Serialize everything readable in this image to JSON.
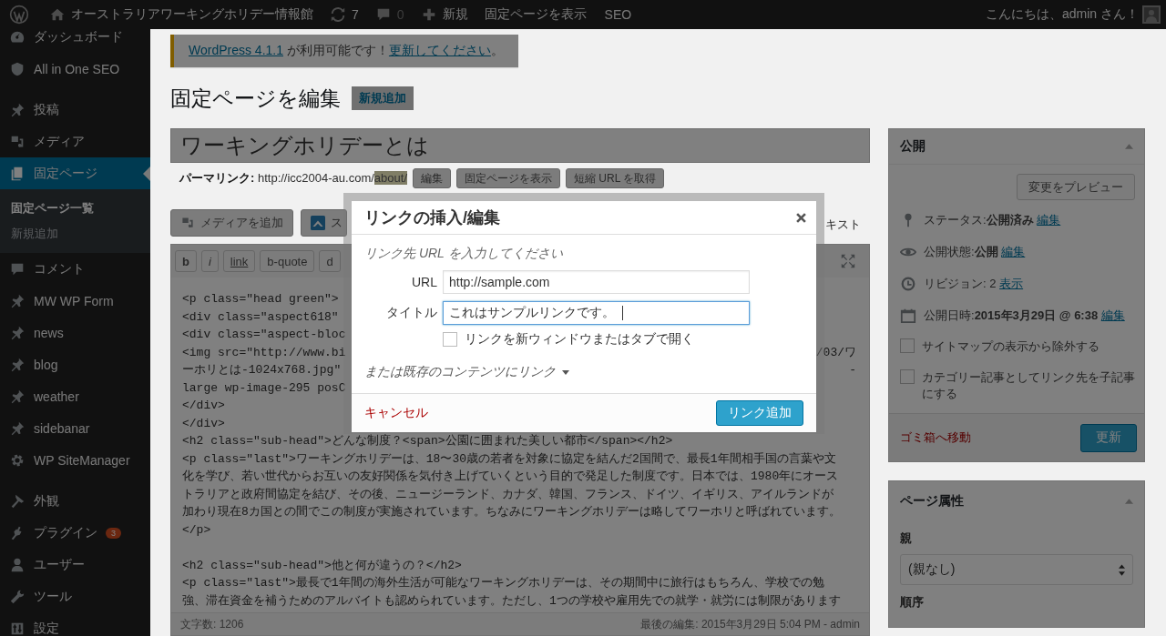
{
  "admin_bar": {
    "site_name": "オーストラリアワーキングホリデー情報館",
    "updates": "7",
    "comments": "0",
    "new": "新規",
    "view_page": "固定ページを表示",
    "seo": "SEO",
    "greeting": "こんにちは、admin さん！"
  },
  "sidebar": {
    "groups": [
      [
        {
          "label": "ダッシュボード",
          "selected": false
        },
        {
          "label": "All in One SEO",
          "selected": false
        }
      ],
      [
        {
          "label": "投稿",
          "selected": false
        },
        {
          "label": "メディア",
          "selected": false
        },
        {
          "label": "固定ページ",
          "selected": true,
          "children": [
            {
              "label": "固定ページ一覧",
              "selected": true
            },
            {
              "label": "新規追加",
              "selected": false
            }
          ]
        },
        {
          "label": "コメント",
          "selected": false
        },
        {
          "label": "MW WP Form",
          "selected": false
        },
        {
          "label": "news",
          "selected": false
        },
        {
          "label": "blog",
          "selected": false
        },
        {
          "label": "weather",
          "selected": false
        },
        {
          "label": "sidebanar",
          "selected": false
        },
        {
          "label": "WP SiteManager",
          "selected": false
        }
      ],
      [
        {
          "label": "外観",
          "selected": false
        },
        {
          "label": "プラグイン",
          "selected": false,
          "badge": "3"
        },
        {
          "label": "ユーザー",
          "selected": false
        },
        {
          "label": "ツール",
          "selected": false
        },
        {
          "label": "設定",
          "selected": false
        }
      ]
    ]
  },
  "notice": {
    "version_link": "WordPress 4.1.1",
    "message": "が利用可能です！",
    "update_link": "更新してください",
    "end": "。"
  },
  "page": {
    "heading": "固定ページを編集",
    "add_new": "新規追加",
    "title": "ワーキングホリデーとは",
    "permalink": {
      "label": "パーマリンク:",
      "base": "http://icc2004-au.com/",
      "slug": "about/",
      "buttons": [
        "編集",
        "固定ページを表示",
        "短縮 URL を取得"
      ]
    }
  },
  "editor": {
    "media_buttons": [
      "メディアを追加",
      "ス"
    ],
    "tab": "キスト",
    "quicktags": [
      "b",
      "i",
      "link",
      "b-quote",
      "d"
    ],
    "lines": [
      {
        "left": "<p class=\"head green\">"
      },
      {
        "left": "<div class=\"aspect618\""
      },
      {
        "left": "<div class=\"aspect-bloc"
      },
      {
        "left": "<img src=\"http://www.bi",
        "right": "/03/ワ"
      },
      {
        "left": "ーホリとは-1024x768.jpg\"",
        "right": "-"
      },
      {
        "left": "large wp-image-295 posC"
      },
      {
        "left": "</div>"
      },
      {
        "left": "</div>"
      },
      {
        "left": "<h2 class=\"sub-head\">どんな制度？<span>公園に囲まれた美しい都市</span></h2>"
      },
      {
        "left": "<p class=\"last\">ワーキングホリデーは、18〜30歳の若者を対象に協定を結んだ2国間で、最長1年間相手国の言葉や文"
      },
      {
        "left": "化を学び、若い世代からお互いの友好関係を気付き上げていくという目的で発足した制度です。日本では、1980年にオース"
      },
      {
        "left": "トラリアと政府間協定を結び、その後、ニュージーランド、カナダ、韓国、フランス、ドイツ、イギリス、アイルランドが"
      },
      {
        "left": "加わり現在8カ国との間でこの制度が実施されています。ちなみにワーキングホリデーは略してワーホリと呼ばれています。"
      },
      {
        "left": "</p>"
      },
      {
        "left": "<h2 class=\"sub-head\">他と何が違うの？</h2>",
        "blank_before": true
      },
      {
        "left": "<p class=\"last\">最長で1年間の海外生活が可能なワーキングホリデーは、その期間中に旅行はもちろん、学校での勉"
      },
      {
        "left": "強、滞在資金を補うためのアルバイトも認められています。ただし、1つの学校や雇用先での就学・就労には制限があります"
      }
    ],
    "word_count": "文字数: 1206",
    "last_edited": "最後の編集: 2015年3月29日 5:04 PM - admin"
  },
  "publish": {
    "title": "公開",
    "preview": "変更をプレビュー",
    "rows": [
      {
        "label": "ステータス:",
        "value": "公開済み",
        "link": "編集"
      },
      {
        "label": "公開状態:",
        "value": "公開",
        "link": "編集"
      },
      {
        "label": "リビジョン: 2",
        "link": "表示"
      },
      {
        "label": "公開日時:",
        "value": "2015年3月29日 @ 6:38",
        "link": "編集"
      }
    ],
    "checkboxes": [
      {
        "label": "サイトマップの表示から除外する",
        "checked": false
      },
      {
        "label": "カテゴリー記事としてリンク先を子記事にする",
        "checked": false
      }
    ],
    "trash": "ゴミ箱へ移動",
    "update": "更新"
  },
  "page_attributes": {
    "title": "ページ属性",
    "parent_label": "親",
    "parent_value": "(親なし)",
    "order_label": "順序"
  },
  "link_dialog": {
    "title": "リンクの挿入/編集",
    "hint": "リンク先 URL を入力してください",
    "fields": [
      {
        "label": "URL",
        "value": "http://sample.com",
        "focused": false
      },
      {
        "label": "タイトル",
        "value": "これはサンプルリンクです。",
        "focused": true
      }
    ],
    "new_tab": {
      "label": "リンクを新ウィンドウまたはタブで開く",
      "checked": false
    },
    "existing_content": {
      "label": "または既存のコンテンツにリンク",
      "expanded": false
    },
    "cancel": "キャンセル",
    "submit": "リンク追加"
  }
}
